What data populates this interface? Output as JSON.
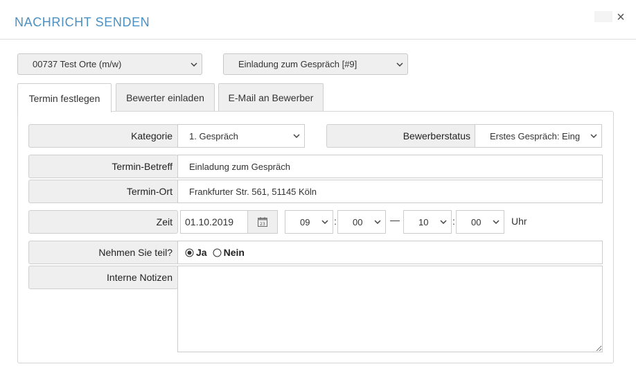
{
  "dialog": {
    "title": "NACHRICHT SENDEN",
    "close_symbol": "×"
  },
  "top_selects": {
    "job": "00737 Test Orte (m/w)",
    "template": "Einladung zum Gespräch [#9]"
  },
  "tabs": [
    {
      "label": "Termin festlegen",
      "active": true
    },
    {
      "label": "Bewerter einladen",
      "active": false
    },
    {
      "label": "E-Mail an Bewerber",
      "active": false
    }
  ],
  "form": {
    "kategorie": {
      "label": "Kategorie",
      "value": "1. Gespräch"
    },
    "bewerberstatus": {
      "label": "Bewerberstatus",
      "value": "Erstes Gespräch: Eing"
    },
    "betreff": {
      "label": "Termin-Betreff",
      "value": "Einladung zum Gespräch"
    },
    "ort": {
      "label": "Termin-Ort",
      "value": "Frankfurter Str. 561, 51145 Köln"
    },
    "zeit": {
      "label": "Zeit",
      "date": "01.10.2019",
      "calendar_day": "23",
      "start_hour": "09",
      "start_min": "00",
      "end_hour": "10",
      "end_min": "00",
      "colon": ":",
      "dash": "—",
      "unit": "Uhr"
    },
    "teilnahme": {
      "label": "Nehmen Sie teil?",
      "yes": "Ja",
      "no": "Nein",
      "selected": "yes"
    },
    "notizen": {
      "label": "Interne Notizen",
      "value": ""
    }
  }
}
